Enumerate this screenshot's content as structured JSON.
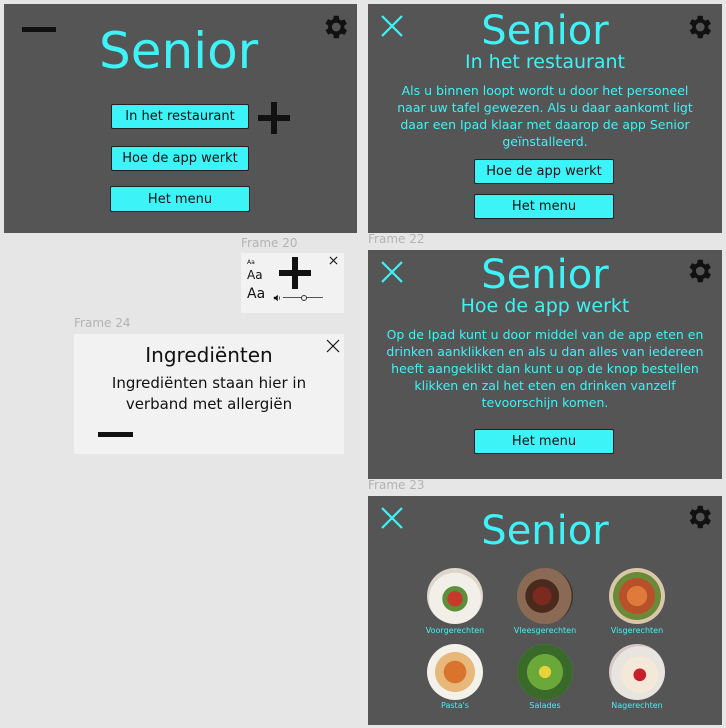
{
  "colors": {
    "frame_bg": "#555555",
    "accent": "#3ef3f7",
    "button_bg": "#3cf4f8",
    "canvas": "#e6e6e6"
  },
  "frame1": {
    "title": "Senior",
    "buttons": [
      "In het restaurant",
      "Hoe de app werkt",
      "Het menu"
    ]
  },
  "frame_restaurant": {
    "title": "Senior",
    "subtitle": "In het restaurant",
    "body": "Als u binnen loopt wordt u door het personeel naar uw tafel gewezen. Als u daar aankomt ligt daar een Ipad klaar met daarop de app Senior geïnstalleerd.",
    "buttons": [
      "Hoe de app werkt",
      "Het menu"
    ]
  },
  "label_frame22": "Frame 22",
  "frame_app": {
    "title": "Senior",
    "subtitle": "Hoe de app werkt",
    "body": "Op de Ipad kunt u door middel van de app eten en drinken aanklikken en als u dan alles van iedereen heeft aangeklikt dan kunt u op de knop bestellen klikken en zal het eten en drinken vanzelf tevoorschijn komen.",
    "button": "Het menu"
  },
  "label_frame23": "Frame 23",
  "frame_menu": {
    "title": "Senior",
    "categories": [
      "Voorgerechten",
      "Vleesgerechten",
      "Visgerechten",
      "Pasta's",
      "Salades",
      "Nagerechten"
    ]
  },
  "label_frame20": "Frame 20",
  "frame20": {
    "aa_small": "Aa",
    "aa_medium": "Aa",
    "aa_large": "Aa",
    "volume_level": 0.45
  },
  "label_frame24": "Frame 24",
  "frame24": {
    "title": "Ingrediënten",
    "body": "Ingrediënten staan hier in verband met allergiën"
  },
  "icons": {
    "settings": "gear-icon",
    "close": "close-icon",
    "plus": "plus-icon",
    "minus": "minus-icon",
    "volume": "speaker-icon"
  }
}
